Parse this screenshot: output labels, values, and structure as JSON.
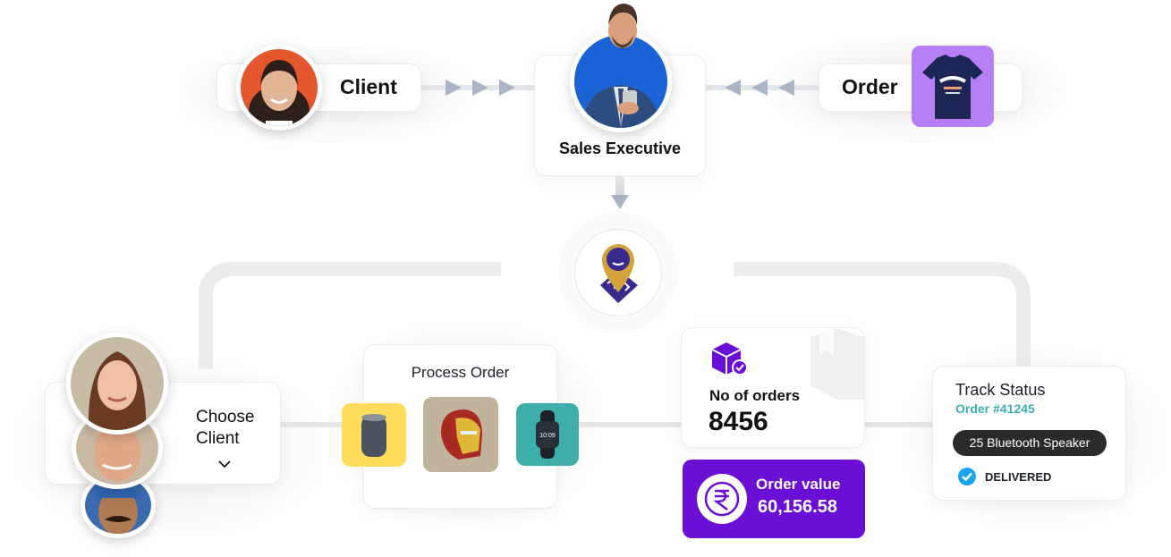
{
  "top": {
    "client_label": "Client",
    "sales_label": "Sales Executive",
    "order_label": "Order"
  },
  "hub": {
    "icon": "location-pin-logo-icon"
  },
  "choose_client": {
    "label_line1": "Choose",
    "label_line2": "Client",
    "dropdown_icon": "chevron-down-icon"
  },
  "process_order": {
    "title": "Process Order",
    "products": [
      {
        "name": "bluetooth-speaker",
        "bg": "#ffdc5c"
      },
      {
        "name": "iron-man-helmet",
        "bg": "#c2b49c"
      },
      {
        "name": "smart-watch",
        "bg": "#3eaeab",
        "time": "10:09"
      }
    ]
  },
  "orders": {
    "label": "No of orders",
    "count": "8456",
    "icon": "package-check-icon"
  },
  "order_value": {
    "label": "Order value",
    "amount": "60,156.58",
    "currency_icon": "rupee-icon"
  },
  "track": {
    "title": "Track Status",
    "order_id": "Order #41245",
    "item_badge": "25 Bluetooth Speaker",
    "status": "DELIVERED"
  },
  "colors": {
    "purple": "#6b0fd6",
    "teal": "#3aaeb2",
    "tshirt_bg": "#b67ff5",
    "check_blue": "#1aa3ee",
    "pin_gold": "#d4a23a",
    "pin_indigo": "#3a2a8e"
  }
}
